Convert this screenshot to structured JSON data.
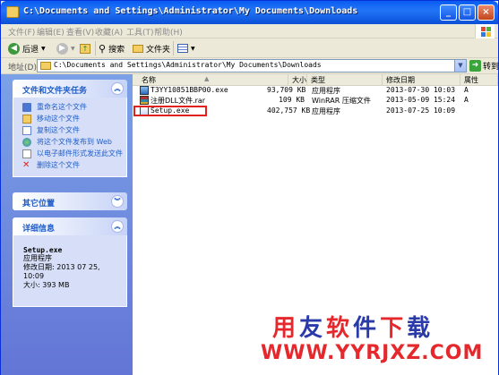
{
  "window": {
    "title": "C:\\Documents and Settings\\Administrator\\My Documents\\Downloads",
    "minimize": "_",
    "maximize": "□",
    "close": "×"
  },
  "menu": [
    "文件(F)",
    "编辑(E)",
    "查看(V)",
    "收藏(A)",
    "工具(T)",
    "帮助(H)"
  ],
  "toolbar": {
    "back": "后退",
    "search": "搜索",
    "folders": "文件夹"
  },
  "address": {
    "label": "地址(D)",
    "value": "C:\\Documents and Settings\\Administrator\\My Documents\\Downloads",
    "go": "转到"
  },
  "tasks": {
    "title": "文件和文件夹任务",
    "items": [
      "重命名这个文件",
      "移动这个文件",
      "复制这个文件",
      "将这个文件发布到 Web",
      "以电子邮件形式发送此文件",
      "删除这个文件"
    ]
  },
  "other": {
    "title": "其它位置"
  },
  "details": {
    "title": "详细信息",
    "name": "Setup.exe",
    "type": "应用程序",
    "modified_label": "修改日期: 2013 07 25,",
    "modified_time": "10:09",
    "size": "大小: 393 MB"
  },
  "columns": {
    "name": "名称",
    "size": "大小",
    "type": "类型",
    "modified": "修改日期",
    "attr": "属性"
  },
  "files": [
    {
      "name": "T3YY10851BBP00.exe",
      "size": "93,709 KB",
      "type": "应用程序",
      "modified": "2013-07-30 10:03",
      "attr": "A"
    },
    {
      "name": "注册DLL文件.rar",
      "size": "109 KB",
      "type": "WinRAR 压缩文件",
      "modified": "2013-05-09 15:24",
      "attr": "A"
    },
    {
      "name": "Setup.exe",
      "size": "402,757 KB",
      "type": "应用程序",
      "modified": "2013-07-25 10:09",
      "attr": ""
    }
  ],
  "watermark": {
    "line1": "用友软件下载",
    "line2": "WWW.YYRJXZ.COM"
  },
  "colors": {
    "titlebar": "#0a5cf2",
    "task_link": "#215dc6",
    "watermark_red": "#e6282d",
    "highlight": "#e0221f"
  }
}
